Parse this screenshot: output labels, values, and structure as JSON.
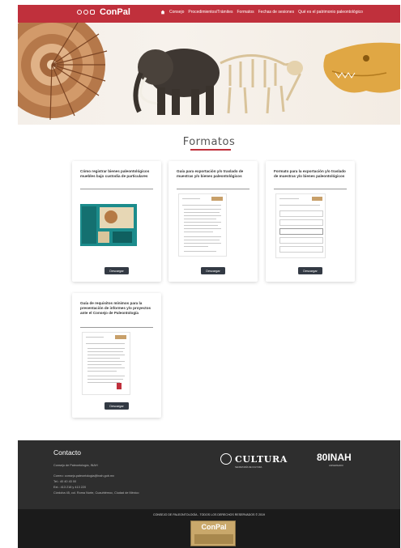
{
  "nav": {
    "logo_text": "ConPal",
    "menu": [
      "Consejo",
      "Procedimientos/Trámites",
      "Formatos",
      "Fechas de sesiones",
      "Qué es el patrimonio paleontológico"
    ]
  },
  "section": {
    "title": "Formatos"
  },
  "cards": [
    {
      "title": "Cómo registrar bienes paleontológicos muebles bajo custodia de particulares",
      "button": "Descargar"
    },
    {
      "title": "Guía para exportación y/o traslado de muestras y/o bienes paleontológicos",
      "button": "Descargar"
    },
    {
      "title": "Formato para la exportación y/o traslado de muestras y/o bienes paleontológicos",
      "button": "Descargar"
    },
    {
      "title": "Guía de requisitos mínimos para la presentación de informes y/o proyectos ante el Consejo de Paleontología",
      "button": "Descargar"
    }
  ],
  "footer": {
    "title": "Contacto",
    "lines": [
      "Consejo de Paleontología, INAH",
      "Correo: consejo.paleontologia@inah.gob.mx",
      "Tel.: 40 40 43 00",
      "Ext.: 413 218 y 413 220",
      "Córdoba 45, col. Roma Norte, Cuauhtémoc, Ciudad de México"
    ],
    "cultura_word": "CULTURA",
    "cultura_sub": "SECRETARÍA DE CULTURA",
    "inah_word": "80INAH",
    "inah_sub": "ANIVERSARIO"
  },
  "bottom": {
    "copyright": "CONSEJO DE PALEONTOLOGÍA - TODOS LOS DERECHOS RESERVADOS © 2019",
    "logo_text": "ConPal"
  },
  "colors": {
    "brand_red": "#c0303c",
    "footer_bg": "#2e2e2e",
    "bottom_bg": "#1b1b1b",
    "button_bg": "#333a44"
  }
}
